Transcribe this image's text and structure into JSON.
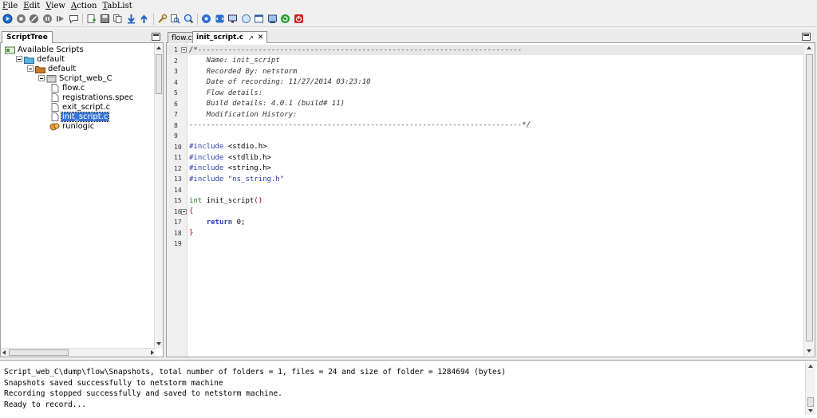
{
  "menu": [
    "File",
    "Edit",
    "View",
    "Action",
    "TabList"
  ],
  "toolbar_icons": [
    "record-icon",
    "stop-icon",
    "cancel-icon",
    "pause-icon",
    "play-icon",
    "comment-icon",
    "add-page-icon",
    "save-icon",
    "copy-icon",
    "download-icon",
    "upload-icon",
    "wrench-icon",
    "search-icon",
    "zoom-icon",
    "settings-icon",
    "code-icon",
    "monitor-icon",
    "globe-icon",
    "window-icon",
    "screen-icon",
    "refresh-icon",
    "power-icon"
  ],
  "left_panel": {
    "tab_label": "ScriptTree",
    "tree": [
      {
        "label": "Available Scripts",
        "indent": 0,
        "icon": "scripts-root-icon",
        "expander": false
      },
      {
        "label": "default",
        "indent": 1,
        "icon": "folder-blue-icon",
        "expander": true
      },
      {
        "label": "default",
        "indent": 2,
        "icon": "folder-brown-icon",
        "expander": true
      },
      {
        "label": "Script_web_C",
        "indent": 3,
        "icon": "script-folder-icon",
        "expander": true
      },
      {
        "label": "flow.c",
        "indent": 4,
        "icon": "file-icon",
        "expander": false
      },
      {
        "label": "registrations.spec",
        "indent": 4,
        "icon": "file-icon",
        "expander": false
      },
      {
        "label": "exit_script.c",
        "indent": 4,
        "icon": "file-icon",
        "expander": false
      },
      {
        "label": "init_script.c",
        "indent": 4,
        "icon": "file-icon",
        "expander": false,
        "selected": true
      },
      {
        "label": "runlogic",
        "indent": 4,
        "icon": "runlogic-icon",
        "expander": false
      }
    ]
  },
  "editor": {
    "tabs": [
      {
        "label": "flow.c",
        "active": false
      },
      {
        "label": "init_script.c",
        "active": true
      }
    ],
    "lines": [
      {
        "n": "1",
        "fold": true,
        "current": true,
        "parts": [
          {
            "t": "/*---------------------------------------------------------------------------",
            "c": "cm"
          }
        ]
      },
      {
        "n": "2",
        "parts": [
          {
            "t": "    Name: init_script",
            "c": "cm"
          }
        ]
      },
      {
        "n": "3",
        "parts": [
          {
            "t": "    Recorded By: netstorm",
            "c": "cm"
          }
        ]
      },
      {
        "n": "4",
        "parts": [
          {
            "t": "    Date of recording: 11/27/2014 03:23:10",
            "c": "cm"
          }
        ]
      },
      {
        "n": "5",
        "parts": [
          {
            "t": "    Flow details:",
            "c": "cm"
          }
        ]
      },
      {
        "n": "6",
        "parts": [
          {
            "t": "    Build details: 4.0.1 (build# 11)",
            "c": "cm"
          }
        ]
      },
      {
        "n": "7",
        "parts": [
          {
            "t": "    Modification History:",
            "c": "cm"
          }
        ]
      },
      {
        "n": "8",
        "parts": [
          {
            "t": "-----------------------------------------------------------------------------*/",
            "c": "cm"
          }
        ]
      },
      {
        "n": "9",
        "parts": []
      },
      {
        "n": "10",
        "parts": [
          {
            "t": "#include",
            "c": "kw-blue"
          },
          {
            "t": " <stdio.h>",
            "c": ""
          }
        ]
      },
      {
        "n": "11",
        "parts": [
          {
            "t": "#include",
            "c": "kw-blue"
          },
          {
            "t": " <stdlib.h>",
            "c": ""
          }
        ]
      },
      {
        "n": "12",
        "parts": [
          {
            "t": "#include",
            "c": "kw-blue"
          },
          {
            "t": " <string.h>",
            "c": ""
          }
        ]
      },
      {
        "n": "13",
        "parts": [
          {
            "t": "#include",
            "c": "kw-blue"
          },
          {
            "t": " ",
            "c": ""
          },
          {
            "t": "\"ns_string.h\"",
            "c": "str"
          }
        ]
      },
      {
        "n": "14",
        "parts": []
      },
      {
        "n": "15",
        "parts": [
          {
            "t": "int",
            "c": "kw-green"
          },
          {
            "t": " init_script",
            "c": ""
          },
          {
            "t": "()",
            "c": "red"
          }
        ]
      },
      {
        "n": "16",
        "fold": true,
        "parts": [
          {
            "t": "{",
            "c": "red"
          }
        ]
      },
      {
        "n": "17",
        "parts": [
          {
            "t": "    ",
            "c": ""
          },
          {
            "t": "return",
            "c": "kw-bold"
          },
          {
            "t": " 0;",
            "c": ""
          }
        ]
      },
      {
        "n": "18",
        "parts": [
          {
            "t": "}",
            "c": "red"
          }
        ]
      },
      {
        "n": "19",
        "parts": []
      }
    ]
  },
  "console": {
    "lines": [
      "Script_web_C\\dump\\flow\\Snapshots, total number of folders = 1, files = 24 and size of folder = 1284694 (bytes)",
      "Snapshots saved successfully to netstorm machine",
      "Recording stopped successfully and saved to netstorm machine.",
      "Ready to record..."
    ]
  }
}
